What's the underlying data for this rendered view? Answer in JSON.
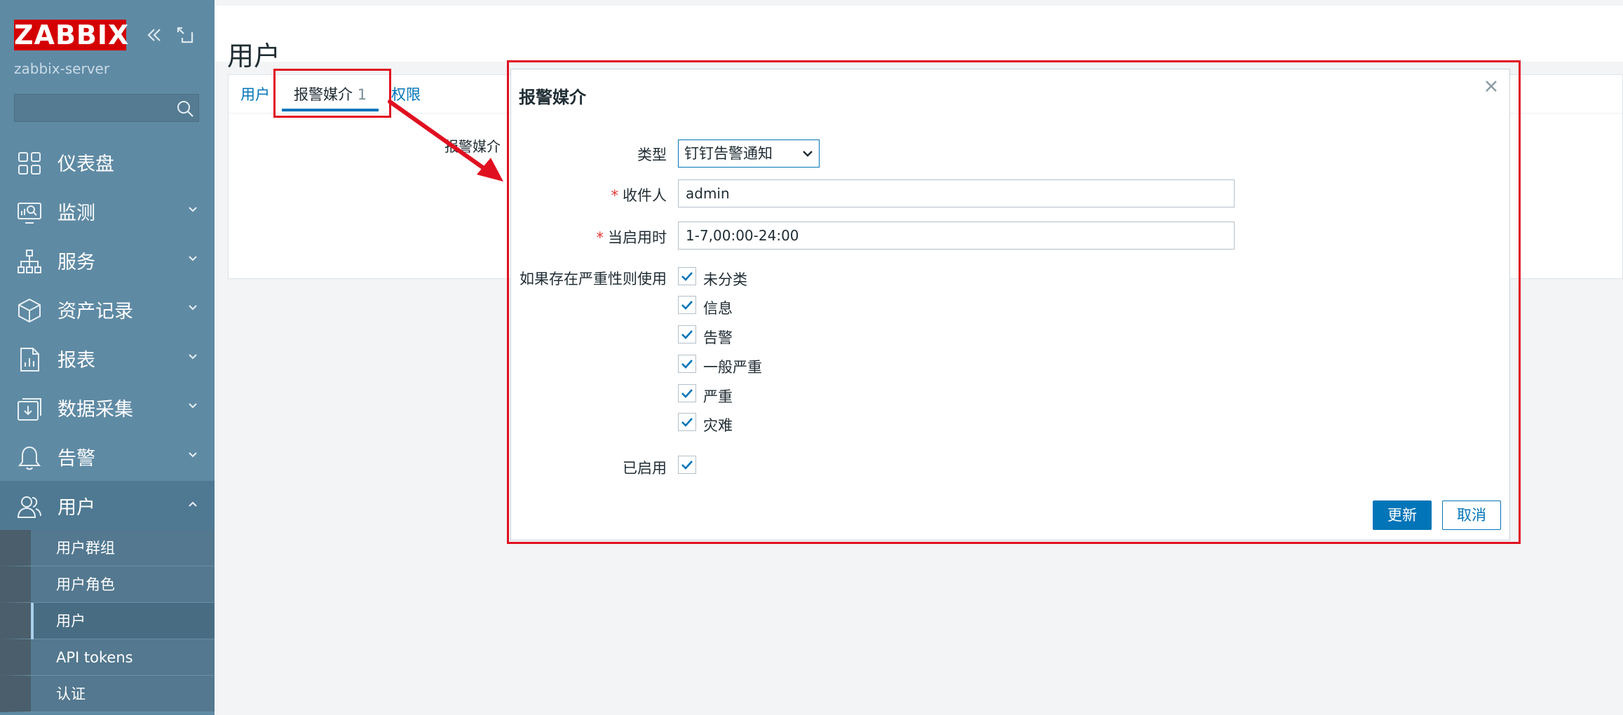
{
  "sidebar": {
    "logo": "ZABBIX",
    "server_name": "zabbix-server",
    "search_placeholder": "",
    "items": [
      {
        "label": "仪表盘",
        "icon": "dashboard-icon"
      },
      {
        "label": "监测",
        "icon": "monitoring-icon"
      },
      {
        "label": "服务",
        "icon": "services-icon"
      },
      {
        "label": "资产记录",
        "icon": "inventory-icon"
      },
      {
        "label": "报表",
        "icon": "reports-icon"
      },
      {
        "label": "数据采集",
        "icon": "data-collection-icon"
      },
      {
        "label": "告警",
        "icon": "alerts-bell-icon"
      },
      {
        "label": "用户",
        "icon": "users-icon"
      }
    ],
    "users_submenu": [
      "用户群组",
      "用户角色",
      "用户",
      "API tokens",
      "认证"
    ]
  },
  "header": {
    "title": "用户"
  },
  "tabs": {
    "user": "用户",
    "media": "报警媒介",
    "media_count": "1",
    "permissions": "权限"
  },
  "behind_label": "报警媒介",
  "dialog": {
    "title": "报警媒介",
    "type_label": "类型",
    "type_value": "钉钉告警通知",
    "sendto_label": "收件人",
    "sendto_value": "admin",
    "period_label": "当启用时",
    "period_value": "1-7,00:00-24:00",
    "severity_label": "如果存在严重性则使用",
    "severities": [
      {
        "label": "未分类",
        "checked": true
      },
      {
        "label": "信息",
        "checked": true
      },
      {
        "label": "告警",
        "checked": true
      },
      {
        "label": "一般严重",
        "checked": true
      },
      {
        "label": "严重",
        "checked": true
      },
      {
        "label": "灾难",
        "checked": true
      }
    ],
    "enabled_label": "已启用",
    "update_button": "更新",
    "cancel_button": "取消"
  },
  "colors": {
    "sidebar_bg": "#5f8aa4",
    "accent": "#0275b8",
    "annotation": "#e01020",
    "logo_bg": "#d40000"
  }
}
